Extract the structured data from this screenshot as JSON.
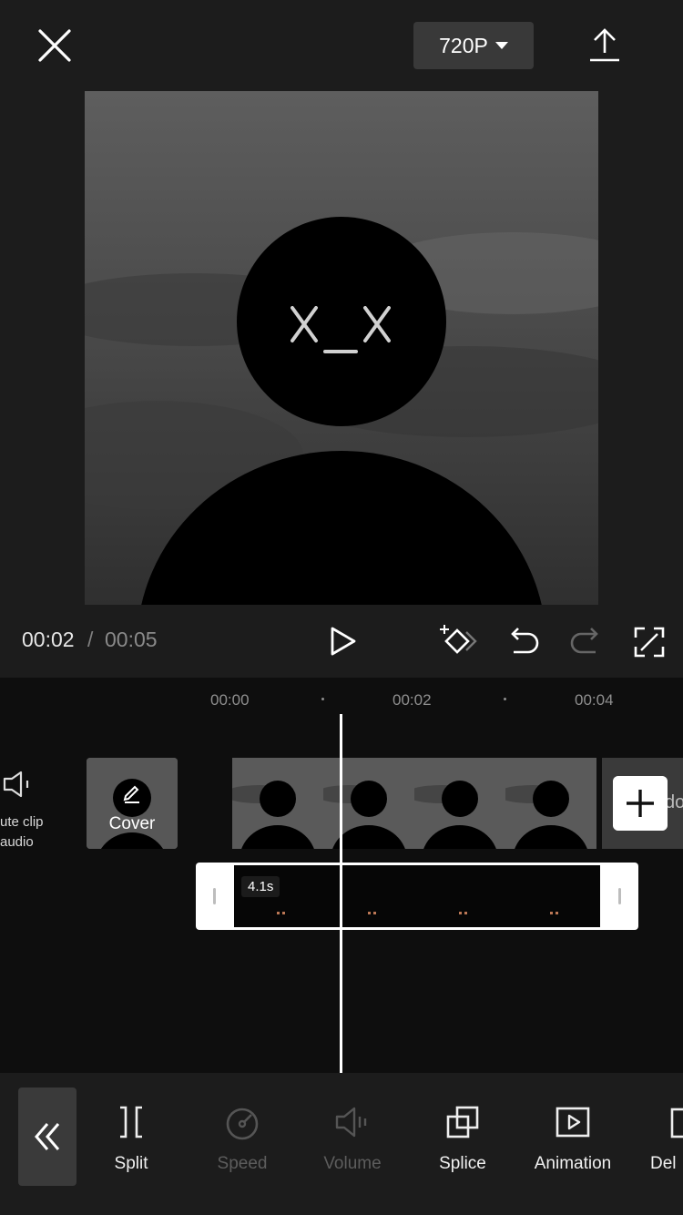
{
  "header": {
    "resolution_label": "720P"
  },
  "player": {
    "current_time": "00:02",
    "separator": "/",
    "total_time": "00:05"
  },
  "timeline": {
    "ruler_labels": [
      "00:00",
      "00:02",
      "00:04"
    ],
    "mute_label_line1": "ute clip",
    "mute_label_line2": "audio",
    "cover_label": "Cover",
    "trail_text": "do",
    "sticker_duration": "4.1s"
  },
  "toolbar": {
    "items": [
      {
        "label": "Split",
        "icon": "split-icon",
        "enabled": true
      },
      {
        "label": "Speed",
        "icon": "speed-icon",
        "enabled": false
      },
      {
        "label": "Volume",
        "icon": "volume-icon",
        "enabled": false
      },
      {
        "label": "Splice",
        "icon": "splice-icon",
        "enabled": true
      },
      {
        "label": "Animation",
        "icon": "animation-icon",
        "enabled": true
      },
      {
        "label": "Del",
        "icon": "delete-icon",
        "enabled": true
      }
    ]
  },
  "colors": {
    "top_bg": "#1c1c1c",
    "timeline_bg": "#0e0e0e",
    "accent_white": "#ffffff",
    "disabled_gray": "#5d5d5d"
  }
}
